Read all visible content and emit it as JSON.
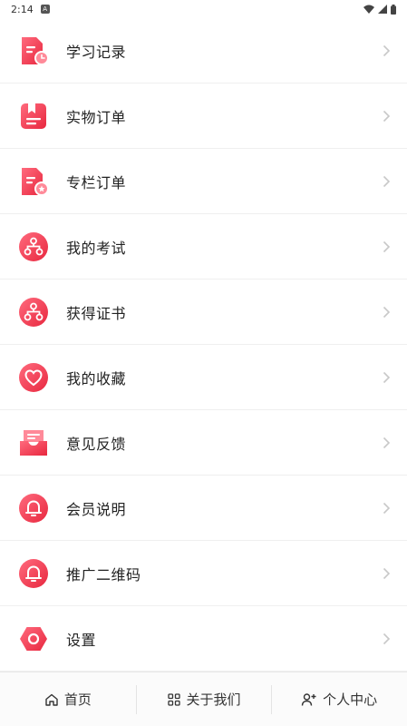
{
  "status_bar": {
    "time": "2:14",
    "badge": "A"
  },
  "colors": {
    "accent": "#ef2f4a",
    "accent_light": "#ff6a7d",
    "chevron": "#c8c8c8"
  },
  "menu": {
    "items": [
      {
        "label": "学习记录",
        "icon": "document-clock-icon"
      },
      {
        "label": "实物订单",
        "icon": "bookmark-doc-icon"
      },
      {
        "label": "专栏订单",
        "icon": "document-star-icon"
      },
      {
        "label": "我的考试",
        "icon": "hierarchy-icon"
      },
      {
        "label": "获得证书",
        "icon": "hierarchy-icon"
      },
      {
        "label": "我的收藏",
        "icon": "heart-icon"
      },
      {
        "label": "意见反馈",
        "icon": "inbox-icon"
      },
      {
        "label": "会员说明",
        "icon": "bell-icon"
      },
      {
        "label": "推广二维码",
        "icon": "bell-icon"
      },
      {
        "label": "设置",
        "icon": "settings-icon"
      }
    ]
  },
  "bottom_nav": {
    "tabs": [
      {
        "label": "首页",
        "icon": "home-icon"
      },
      {
        "label": "关于我们",
        "icon": "grid-icon"
      },
      {
        "label": "个人中心",
        "icon": "user-add-icon"
      }
    ]
  }
}
